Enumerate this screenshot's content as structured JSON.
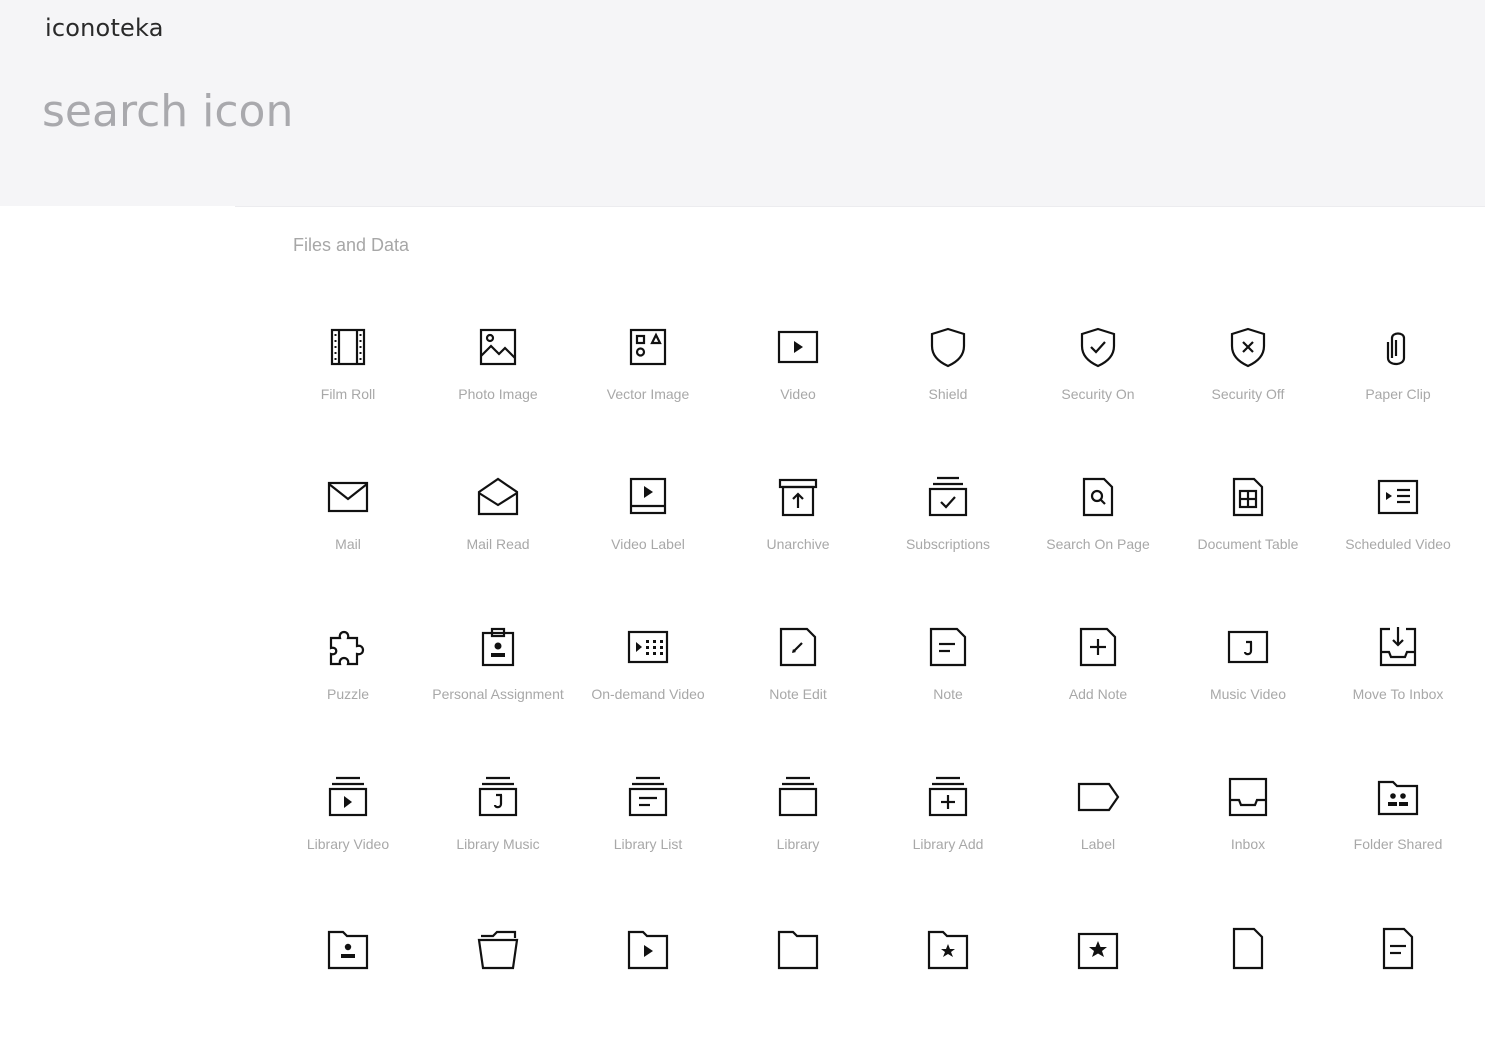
{
  "app": {
    "brand": "iconoteka"
  },
  "search": {
    "placeholder": "search icon",
    "value": ""
  },
  "section": {
    "title": "Files and Data"
  },
  "icons": [
    {
      "label": "Film Roll",
      "icon": "film-roll-icon"
    },
    {
      "label": "Photo Image",
      "icon": "photo-image-icon"
    },
    {
      "label": "Vector Image",
      "icon": "vector-image-icon"
    },
    {
      "label": "Video",
      "icon": "video-icon"
    },
    {
      "label": "Shield",
      "icon": "shield-icon"
    },
    {
      "label": "Security On",
      "icon": "security-on-icon"
    },
    {
      "label": "Security Off",
      "icon": "security-off-icon"
    },
    {
      "label": "Paper Clip",
      "icon": "paper-clip-icon"
    },
    {
      "label": "Mail",
      "icon": "mail-icon"
    },
    {
      "label": "Mail Read",
      "icon": "mail-read-icon"
    },
    {
      "label": "Video Label",
      "icon": "video-label-icon"
    },
    {
      "label": "Unarchive",
      "icon": "unarchive-icon"
    },
    {
      "label": "Subscriptions",
      "icon": "subscriptions-icon"
    },
    {
      "label": "Search On Page",
      "icon": "search-on-page-icon"
    },
    {
      "label": "Document Table",
      "icon": "document-table-icon"
    },
    {
      "label": "Scheduled Video",
      "icon": "scheduled-video-icon"
    },
    {
      "label": "Puzzle",
      "icon": "puzzle-icon"
    },
    {
      "label": "Personal Assignment",
      "icon": "personal-assignment-icon"
    },
    {
      "label": "On-demand Video",
      "icon": "on-demand-video-icon"
    },
    {
      "label": "Note Edit",
      "icon": "note-edit-icon"
    },
    {
      "label": "Note",
      "icon": "note-icon"
    },
    {
      "label": "Add Note",
      "icon": "add-note-icon"
    },
    {
      "label": "Music Video",
      "icon": "music-video-icon"
    },
    {
      "label": "Move To Inbox",
      "icon": "move-to-inbox-icon"
    },
    {
      "label": "Library Video",
      "icon": "library-video-icon"
    },
    {
      "label": "Library Music",
      "icon": "library-music-icon"
    },
    {
      "label": "Library List",
      "icon": "library-list-icon"
    },
    {
      "label": "Library",
      "icon": "library-icon"
    },
    {
      "label": "Library Add",
      "icon": "library-add-icon"
    },
    {
      "label": "Label",
      "icon": "label-icon"
    },
    {
      "label": "Inbox",
      "icon": "inbox-icon"
    },
    {
      "label": "Folder Shared",
      "icon": "folder-shared-icon"
    },
    {
      "label": "",
      "icon": "folder-user-icon"
    },
    {
      "label": "",
      "icon": "folder-open-icon"
    },
    {
      "label": "",
      "icon": "folder-video-icon"
    },
    {
      "label": "",
      "icon": "folder-icon"
    },
    {
      "label": "",
      "icon": "folder-star-icon"
    },
    {
      "label": "",
      "icon": "star-box-icon"
    },
    {
      "label": "",
      "icon": "document-icon"
    },
    {
      "label": "",
      "icon": "document-text-icon"
    }
  ]
}
